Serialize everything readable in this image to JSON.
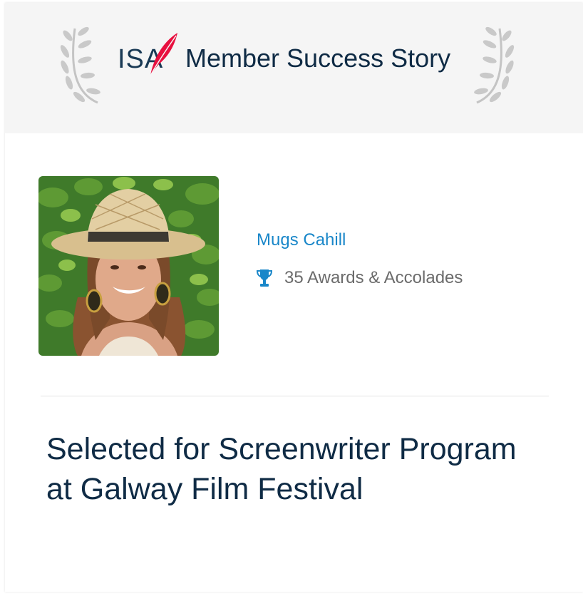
{
  "header": {
    "logo_text": "IS",
    "logo_accent": "A",
    "title": "Member Success Story"
  },
  "member": {
    "name": "Mugs Cahill",
    "awards_label": "35 Awards & Accolades"
  },
  "story": {
    "headline": "Selected for Screenwriter Program at Galway Film Festival"
  },
  "icons": {
    "laurel_left": "laurel-branch-icon",
    "laurel_right": "laurel-branch-icon",
    "trophy": "trophy-icon",
    "feather": "quill-feather-icon"
  },
  "colors": {
    "header_bg": "#f5f5f5",
    "link_blue": "#1a87c9",
    "dark_navy": "#0f2b45",
    "feather_red": "#e8103f",
    "muted_text": "#6b6b6b"
  }
}
